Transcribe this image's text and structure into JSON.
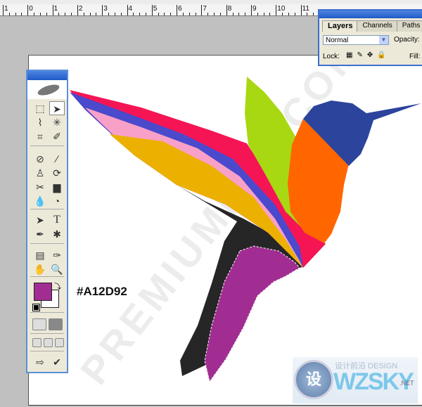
{
  "ruler": {
    "labels": [
      "1",
      "0",
      "1",
      "2",
      "3",
      "4",
      "5",
      "6",
      "7",
      "8",
      "9",
      "10",
      "11"
    ]
  },
  "canvas": {
    "hex_label": "#A12D92",
    "watermark_text": "PREMIUMPSD.COM"
  },
  "colors": {
    "foreground": "#A12D92",
    "background": "#FFFFFF",
    "wing_red": "#f51555",
    "wing_blue": "#4b49cc",
    "wing_pink": "#f8a0c8",
    "wing_yellow": "#ecb000",
    "body_black": "#262626",
    "tail_purple": "#a12d92",
    "green_wing": "#a8d811",
    "chest_orange": "#ff6600",
    "head_blue": "#2c449c"
  },
  "toolbox": {
    "tools": [
      "rectangular-marquee",
      "move",
      "polygonal-lasso",
      "magic-wand",
      "crop",
      "slice",
      "healing-brush",
      "brush",
      "clone-stamp",
      "history-brush",
      "eraser",
      "gradient",
      "blur",
      "dodge",
      "path-selection",
      "type",
      "pen",
      "custom-shape",
      "notes",
      "eyedropper",
      "hand",
      "zoom"
    ],
    "type_tool_label": "T"
  },
  "layers_panel": {
    "tabs": [
      "Layers",
      "Channels",
      "Paths"
    ],
    "active_tab": "Layers",
    "blend_mode": "Normal",
    "opacity_label": "Opacity:",
    "lock_label": "Lock:",
    "fill_label": "Fill:"
  },
  "logo": {
    "badge": "设",
    "name": "WZSKY",
    "sub": "设计前沿 DESIGN",
    "tld": ".NET"
  }
}
